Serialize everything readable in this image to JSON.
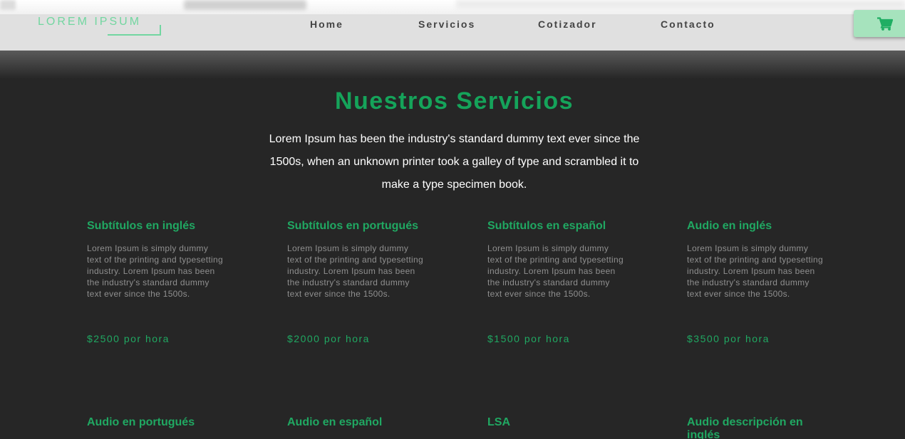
{
  "header": {
    "logo": "LOREM IPSUM",
    "nav": [
      "Home",
      "Servicios",
      "Cotizador",
      "Contacto"
    ],
    "cart_icon": "shopping-cart-icon"
  },
  "colors": {
    "accent": "#15a35a",
    "header_bg": "#e0e0e0",
    "page_bg": "#262626",
    "cart_bg": "#a6e3bd"
  },
  "section": {
    "title": "Nuestros Servicios",
    "intro": "Lorem Ipsum has been the industry's standard dummy text ever since the 1500s, when an unknown printer took a galley of type and scrambled it to make a type specimen book."
  },
  "services": [
    {
      "title": "Subtítulos en inglés",
      "desc": "Lorem Ipsum is simply dummy text of the printing and typesetting industry. Lorem Ipsum has been the industry's standard dummy text ever since the 1500s.",
      "price": "$2500 por hora"
    },
    {
      "title": "Subtítulos en portugués",
      "desc": "Lorem Ipsum is simply dummy text of the printing and typesetting industry. Lorem Ipsum has been the industry's standard dummy text ever since the 1500s.",
      "price": "$2000 por hora"
    },
    {
      "title": "Subtítulos en español",
      "desc": "Lorem Ipsum is simply dummy text of the printing and typesetting industry. Lorem Ipsum has been the industry's standard dummy text ever since the 1500s.",
      "price": "$1500 por hora"
    },
    {
      "title": "Audio en inglés",
      "desc": "Lorem Ipsum is simply dummy text of the printing and typesetting industry. Lorem Ipsum has been the industry's standard dummy text ever since the 1500s.",
      "price": "$3500 por hora"
    },
    {
      "title": "Audio en portugués"
    },
    {
      "title": "Audio en español"
    },
    {
      "title": "LSA"
    },
    {
      "title": "Audio descripción en inglés"
    }
  ]
}
